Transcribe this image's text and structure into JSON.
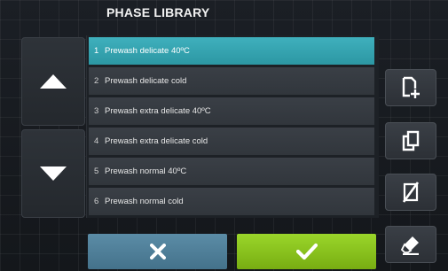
{
  "header": {
    "title": "PHASE LIBRARY"
  },
  "phases": [
    {
      "number": "1",
      "label": "Prewash delicate 40ºC"
    },
    {
      "number": "2",
      "label": "Prewash delicate cold"
    },
    {
      "number": "3",
      "label": "Prewash extra delicate 40ºC"
    },
    {
      "number": "4",
      "label": "Prewash extra delicate cold"
    },
    {
      "number": "5",
      "label": "Prewash normal 40ºC"
    },
    {
      "number": "6",
      "label": "Prewash normal cold"
    }
  ],
  "selected_phase": "1",
  "icons": {
    "scroll_up": "triangle-up-icon",
    "scroll_down": "triangle-down-icon",
    "new": "new-document-icon",
    "copy": "copy-icon",
    "delete": "delete-icon",
    "edit": "edit-eraser-icon",
    "cancel": "x-icon",
    "confirm": "checkmark-icon"
  },
  "colors": {
    "selected": "#36a4b0",
    "item": "#353a40",
    "cancel": "#4f82a0",
    "confirm": "#88c21f",
    "background": "#161a1f"
  }
}
